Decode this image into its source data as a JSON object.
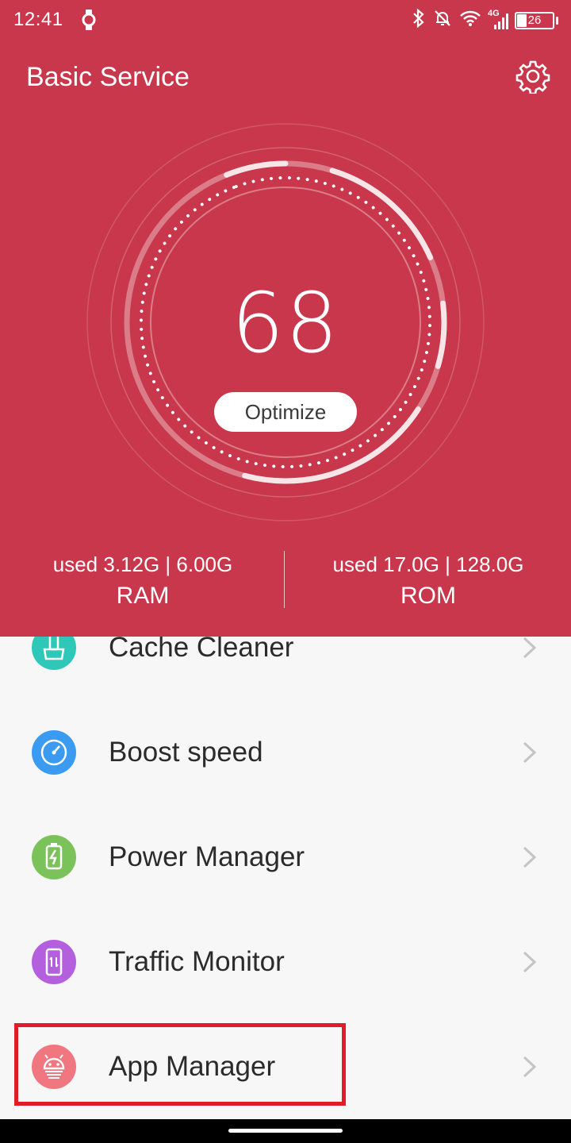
{
  "status_bar": {
    "time": "12:41",
    "network": "4G",
    "battery": "26",
    "icons": [
      "watch-icon",
      "bluetooth-icon",
      "do-not-disturb-icon",
      "wifi-icon",
      "signal-icon",
      "battery-icon"
    ]
  },
  "header": {
    "title": "Basic Service",
    "settings_icon": "gear-icon",
    "background": "#c8374b"
  },
  "gauge": {
    "score": "68",
    "button_label": "Optimize"
  },
  "stats": {
    "ram": {
      "used": "used 3.12G | 6.00G",
      "label": "RAM"
    },
    "rom": {
      "used": "used 17.0G | 128.0G",
      "label": "ROM"
    }
  },
  "menu": {
    "items": [
      {
        "label": "Cache Cleaner",
        "icon": "broom-icon",
        "color": "#2ec7b8"
      },
      {
        "label": "Boost speed",
        "icon": "speedometer-icon",
        "color": "#3a9bf0"
      },
      {
        "label": "Power Manager",
        "icon": "battery-charge-icon",
        "color": "#7cc25a"
      },
      {
        "label": "Traffic Monitor",
        "icon": "phone-traffic-icon",
        "color": "#b35fde"
      },
      {
        "label": "App Manager",
        "icon": "android-icon",
        "color": "#f0767f"
      }
    ]
  }
}
